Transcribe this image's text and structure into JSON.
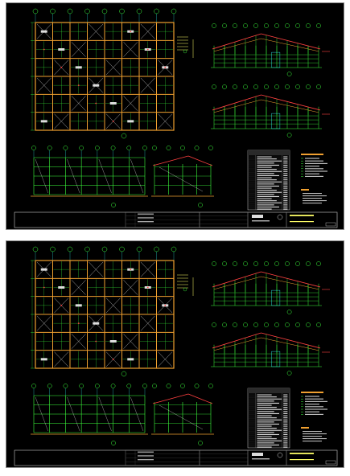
{
  "sheets": [
    {
      "id": "sheet-1",
      "views": [
        {
          "key": "frame-elevation",
          "caption": "",
          "scale_marker": ""
        },
        {
          "key": "roof-truss-elevation-upper",
          "caption": "",
          "scale_marker": ""
        },
        {
          "key": "roof-truss-elevation-lower",
          "caption": "",
          "scale_marker": ""
        },
        {
          "key": "side-frame-elevation",
          "caption": "",
          "scale_marker": ""
        },
        {
          "key": "end-frame-elevation",
          "caption": "",
          "scale_marker": ""
        }
      ],
      "schedule_table": {
        "title": "",
        "rows": []
      },
      "legend": {
        "title": "",
        "items": []
      },
      "notes": {
        "title": "",
        "items": []
      },
      "title_block": {
        "revisions": [],
        "project": "",
        "sheet_title": "",
        "sheet_number": ""
      }
    },
    {
      "id": "sheet-2",
      "views": [
        {
          "key": "frame-elevation",
          "caption": "",
          "scale_marker": ""
        },
        {
          "key": "roof-truss-elevation-upper",
          "caption": "",
          "scale_marker": ""
        },
        {
          "key": "roof-truss-elevation-lower",
          "caption": "",
          "scale_marker": ""
        },
        {
          "key": "side-frame-elevation",
          "caption": "",
          "scale_marker": ""
        },
        {
          "key": "end-frame-elevation",
          "caption": "",
          "scale_marker": ""
        }
      ],
      "schedule_table": {
        "title": "",
        "rows": []
      },
      "legend": {
        "title": "",
        "items": []
      },
      "notes": {
        "title": "",
        "items": []
      },
      "title_block": {
        "revisions": [],
        "project": "",
        "sheet_title": "",
        "sheet_number": ""
      }
    }
  ],
  "colors": {
    "background": "#000000",
    "frame": "#f0a030",
    "structure_green": "#3cff3c",
    "grid_cyan": "#33ffff",
    "roof_red": "#ff4040",
    "text_yellow": "#ffff66",
    "title_border": "#c8c8c8",
    "dark_panel": "#1a1a1a"
  }
}
